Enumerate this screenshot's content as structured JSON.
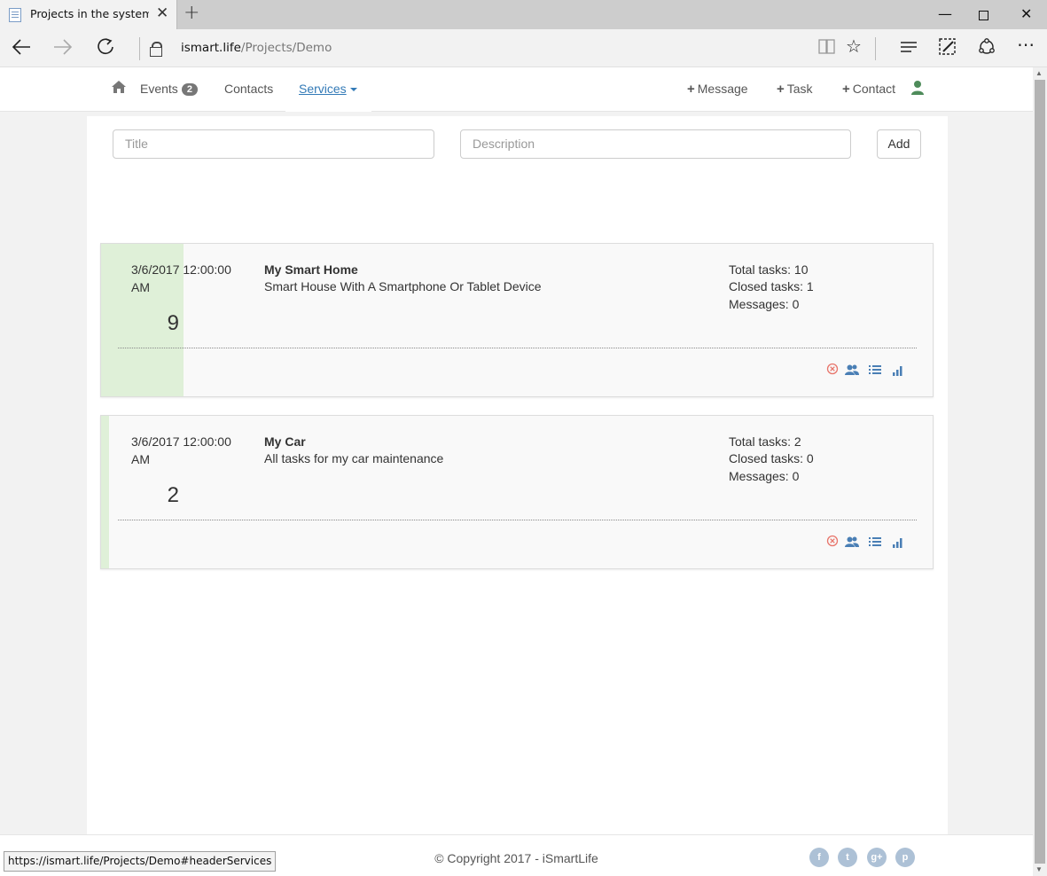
{
  "browser": {
    "tab_title": "Projects in the system. C",
    "url_host": "ismart.life",
    "url_path": "/Projects/Demo",
    "status_url": "https://ismart.life/Projects/Demo#headerServices"
  },
  "navbar": {
    "events_label": "Events",
    "events_badge": "2",
    "contacts_label": "Contacts",
    "services_label": "Services",
    "actions": {
      "message": "Message",
      "task": "Task",
      "contact": "Contact"
    }
  },
  "form": {
    "title_placeholder": "Title",
    "description_placeholder": "Description",
    "add_label": "Add"
  },
  "projects": [
    {
      "date": "3/6/2017 12:00:00 AM",
      "count": "9",
      "name": "My Smart Home",
      "description": "Smart House With A Smartphone Or Tablet Device",
      "total_tasks": "Total tasks: 10",
      "closed_tasks": "Closed tasks: 1",
      "messages": "Messages: 0",
      "progress": 0.1
    },
    {
      "date": "3/6/2017 12:00:00 AM",
      "count": "2",
      "name": "My Car",
      "description": "All tasks for my car maintenance",
      "total_tasks": "Total tasks: 2",
      "closed_tasks": "Closed tasks: 0",
      "messages": "Messages: 0",
      "progress": 0
    }
  ],
  "footer": {
    "copyright": "© Copyright 2017 - iSmartLife",
    "social": [
      "f",
      "t",
      "g+",
      "p"
    ]
  },
  "colors": {
    "accent": "#337ab7",
    "progress_bar": "#dff0d8",
    "delete_icon": "#e8756b",
    "action_icon": "#4a7fb5",
    "user_icon": "#4e8b5a"
  }
}
